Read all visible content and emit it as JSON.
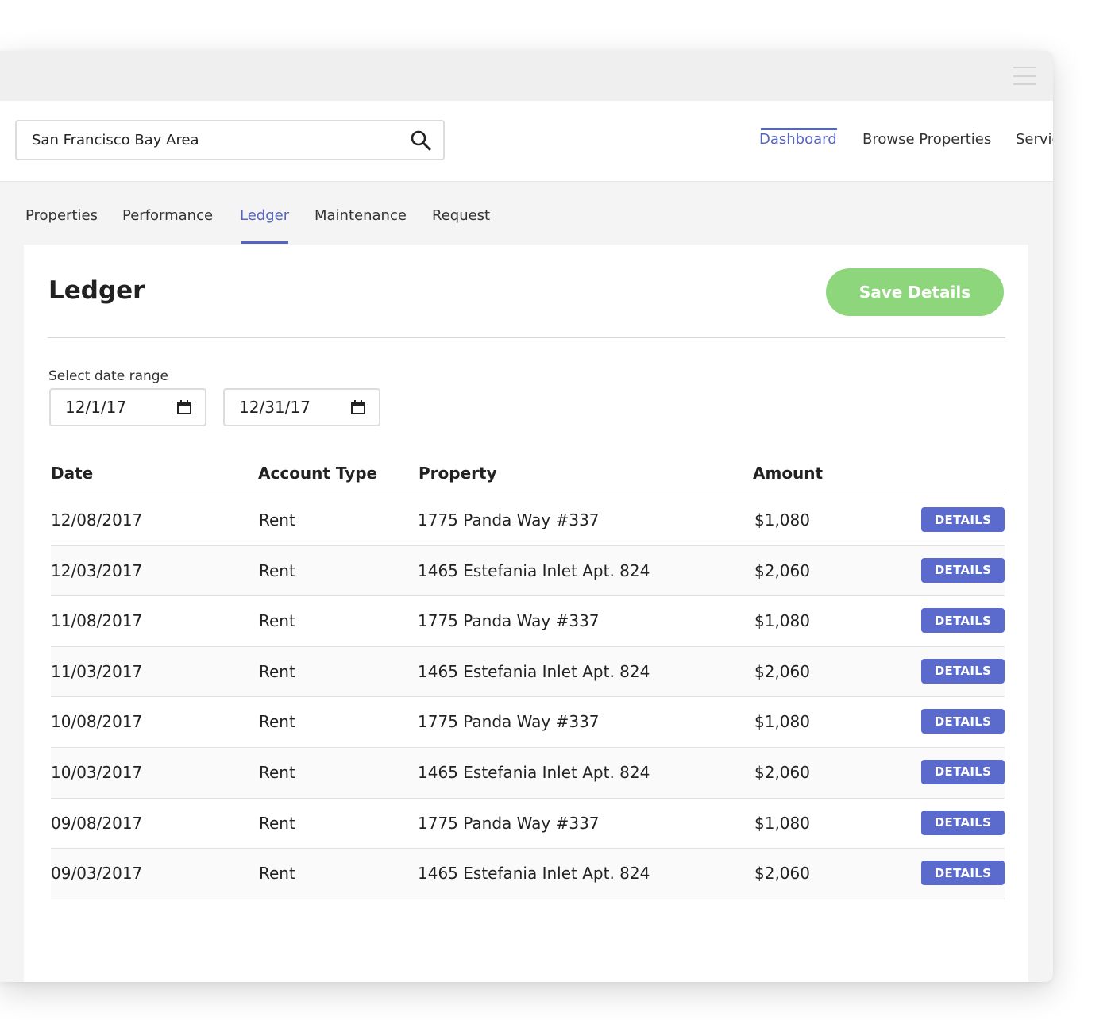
{
  "search": {
    "value": "San Francisco Bay Area"
  },
  "topnav": {
    "items": [
      {
        "label": "Dashboard",
        "active": true
      },
      {
        "label": "Browse Properties",
        "active": false
      },
      {
        "label": "Servic",
        "active": false
      }
    ]
  },
  "subnav": {
    "tabs": [
      {
        "label": "Properties",
        "active": false
      },
      {
        "label": "Performance",
        "active": false
      },
      {
        "label": "Ledger",
        "active": true
      },
      {
        "label": "Maintenance",
        "active": false
      },
      {
        "label": "Request",
        "active": false
      }
    ]
  },
  "ledger": {
    "title": "Ledger",
    "save_label": "Save Details",
    "date_range": {
      "label": "Select date range",
      "start": "12/1/17",
      "end": "12/31/17"
    },
    "columns": [
      "Date",
      "Account Type",
      "Property",
      "Amount"
    ],
    "details_label": "DETAILS",
    "rows": [
      {
        "date": "12/08/2017",
        "type": "Rent",
        "property": "1775 Panda Way #337",
        "amount": "$1,080"
      },
      {
        "date": "12/03/2017",
        "type": "Rent",
        "property": "1465 Estefania Inlet Apt. 824",
        "amount": "$2,060"
      },
      {
        "date": "11/08/2017",
        "type": "Rent",
        "property": "1775 Panda Way #337",
        "amount": "$1,080"
      },
      {
        "date": "11/03/2017",
        "type": "Rent",
        "property": "1465 Estefania Inlet Apt. 824",
        "amount": "$2,060"
      },
      {
        "date": "10/08/2017",
        "type": "Rent",
        "property": "1775 Panda Way #337",
        "amount": "$1,080"
      },
      {
        "date": "10/03/2017",
        "type": "Rent",
        "property": "1465 Estefania Inlet Apt. 824",
        "amount": "$2,060"
      },
      {
        "date": "09/08/2017",
        "type": "Rent",
        "property": "1775 Panda Way #337",
        "amount": "$1,080"
      },
      {
        "date": "09/03/2017",
        "type": "Rent",
        "property": "1465 Estefania Inlet Apt. 824",
        "amount": "$2,060"
      }
    ]
  },
  "colors": {
    "accent": "#5563c1",
    "save_button": "#8ed67c",
    "details_button": "#5a6acd"
  }
}
